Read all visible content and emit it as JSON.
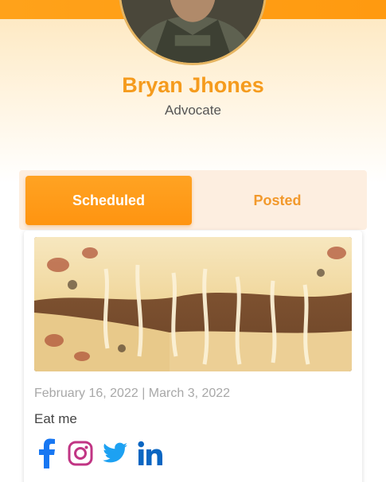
{
  "profile": {
    "name": "Bryan Jhones",
    "role": "Advocate"
  },
  "tabs": [
    {
      "label": "Scheduled",
      "active": true
    },
    {
      "label": "Posted",
      "active": false
    }
  ],
  "post": {
    "dates": "February 16, 2022 | March 3, 2022",
    "caption": "Eat me",
    "image": "pizza-cheese-pull-image"
  },
  "social_icons": [
    "facebook-icon",
    "instagram-icon",
    "twitter-icon",
    "linkedin-icon"
  ],
  "colors": {
    "accent": "#ff9a10",
    "name": "#f59b1d",
    "facebook": "#1877f2",
    "instagram": "#c13584",
    "twitter": "#1da1f2",
    "linkedin": "#0a66c2"
  }
}
